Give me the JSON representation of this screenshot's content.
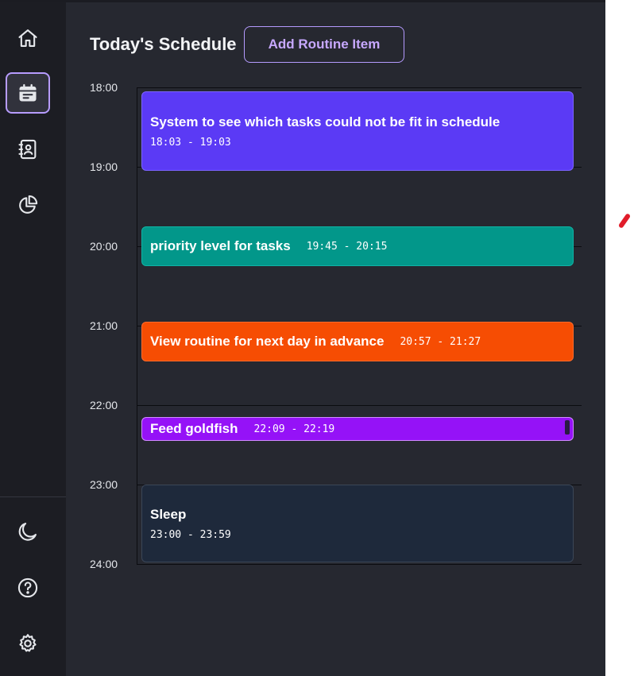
{
  "header": {
    "title": "Today's Schedule",
    "add_button_label": "Add Routine Item"
  },
  "sidebar": {
    "top_items": [
      {
        "icon": "home-icon"
      },
      {
        "icon": "calendar-icon",
        "active": true
      },
      {
        "icon": "contacts-book-icon"
      },
      {
        "icon": "pie-chart-icon"
      }
    ],
    "bottom_items": [
      {
        "icon": "moon-icon"
      },
      {
        "icon": "help-circle-icon"
      },
      {
        "icon": "settings-gear-icon"
      }
    ]
  },
  "timeline": {
    "hours": [
      "18:00",
      "19:00",
      "20:00",
      "21:00",
      "22:00",
      "23:00",
      "24:00"
    ]
  },
  "events": [
    {
      "title": "System to see which tasks could not be fit in schedule",
      "time": "18:03 - 19:03",
      "color": "#5b3af5"
    },
    {
      "title": "priority level for tasks",
      "time": "19:45 - 20:15",
      "color": "#02978a"
    },
    {
      "title": "View routine for next day in advance",
      "time": "20:57 - 21:27",
      "color": "#f64d03"
    },
    {
      "title": "Feed goldfish",
      "time": "22:09 - 22:19",
      "color": "#9512f7"
    },
    {
      "title": "Sleep",
      "time": "23:00 - 23:59",
      "color": "#1e293b"
    }
  ],
  "colors": {
    "accent": "#b79cff",
    "background": "#262830",
    "sidebar": "#1c1d23"
  }
}
